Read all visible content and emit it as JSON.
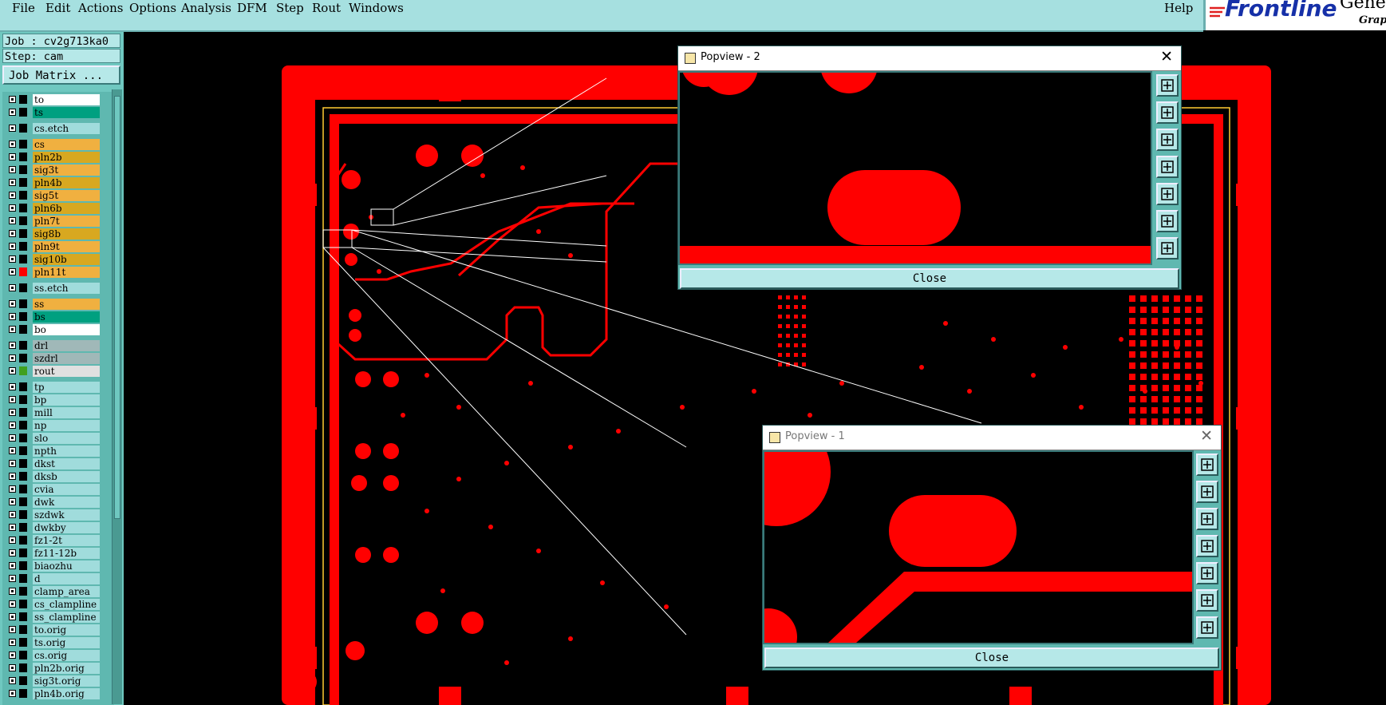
{
  "menubar": {
    "items": [
      "File",
      "Edit",
      "Actions",
      "Options",
      "Analysis",
      "DFM",
      "Step",
      "Rout",
      "Windows"
    ],
    "help": "Help"
  },
  "brand": {
    "name": "Frontline",
    "name2": "Gene",
    "sub": "Graph"
  },
  "job": {
    "job_label": "Job : cv2g713ka0",
    "step_label": "Step: cam",
    "matrix_button": "Job Matrix ..."
  },
  "layers": [
    {
      "name": "to",
      "color": "#ffffff",
      "tick": "#000000"
    },
    {
      "name": "ts",
      "color": "#00a080",
      "tick": "#000000"
    },
    {
      "name": "cs.etch",
      "color": "#a0dcdc",
      "tick": "#000000"
    },
    {
      "name": "cs",
      "color": "#f0b040",
      "tick": "#000000"
    },
    {
      "name": "pln2b",
      "color": "#d8a820",
      "tick": "#000000"
    },
    {
      "name": "sig3t",
      "color": "#f0b040",
      "tick": "#000000"
    },
    {
      "name": "pln4b",
      "color": "#d8a820",
      "tick": "#000000"
    },
    {
      "name": "sig5t",
      "color": "#f0b040",
      "tick": "#000000"
    },
    {
      "name": "pln6b",
      "color": "#d8a820",
      "tick": "#000000"
    },
    {
      "name": "pln7t",
      "color": "#f0b040",
      "tick": "#000000"
    },
    {
      "name": "sig8b",
      "color": "#d8a820",
      "tick": "#000000"
    },
    {
      "name": "pln9t",
      "color": "#f0b040",
      "tick": "#000000"
    },
    {
      "name": "sig10b",
      "color": "#d8a820",
      "tick": "#000000"
    },
    {
      "name": "pln11t",
      "color": "#f0b040",
      "tick": "#ff0000"
    },
    {
      "name": "ss.etch",
      "color": "#a0dcdc",
      "tick": "#000000"
    },
    {
      "name": "ss",
      "color": "#f0b040",
      "tick": "#000000"
    },
    {
      "name": "bs",
      "color": "#00a080",
      "tick": "#000000"
    },
    {
      "name": "bo",
      "color": "#ffffff",
      "tick": "#000000"
    },
    {
      "name": "drl",
      "color": "#a0b8b8",
      "tick": "#000000"
    },
    {
      "name": "szdrl",
      "color": "#a0b8b8",
      "tick": "#000000"
    },
    {
      "name": "rout",
      "color": "#e0e0e0",
      "tick": "#40a020"
    },
    {
      "name": "tp",
      "color": "#a0dcdc",
      "tick": "#000000"
    },
    {
      "name": "bp",
      "color": "#a0dcdc",
      "tick": "#000000"
    },
    {
      "name": "mill",
      "color": "#a0dcdc",
      "tick": "#000000"
    },
    {
      "name": "np",
      "color": "#a0dcdc",
      "tick": "#000000"
    },
    {
      "name": "slo",
      "color": "#a0dcdc",
      "tick": "#000000"
    },
    {
      "name": "npth",
      "color": "#a0dcdc",
      "tick": "#000000"
    },
    {
      "name": "dkst",
      "color": "#a0dcdc",
      "tick": "#000000"
    },
    {
      "name": "dksb",
      "color": "#a0dcdc",
      "tick": "#000000"
    },
    {
      "name": "cvia",
      "color": "#a0dcdc",
      "tick": "#000000"
    },
    {
      "name": "dwk",
      "color": "#a0dcdc",
      "tick": "#000000"
    },
    {
      "name": "szdwk",
      "color": "#a0dcdc",
      "tick": "#000000"
    },
    {
      "name": "dwkby",
      "color": "#a0dcdc",
      "tick": "#000000"
    },
    {
      "name": "fz1-2t",
      "color": "#a0dcdc",
      "tick": "#000000"
    },
    {
      "name": "fz11-12b",
      "color": "#a0dcdc",
      "tick": "#000000"
    },
    {
      "name": "biaozhu",
      "color": "#a0dcdc",
      "tick": "#000000"
    },
    {
      "name": "d",
      "color": "#a0dcdc",
      "tick": "#000000"
    },
    {
      "name": "clamp_area",
      "color": "#a0dcdc",
      "tick": "#000000"
    },
    {
      "name": "cs_clampline",
      "color": "#a0dcdc",
      "tick": "#000000"
    },
    {
      "name": "ss_clampline",
      "color": "#a0dcdc",
      "tick": "#000000"
    },
    {
      "name": "to.orig",
      "color": "#a0dcdc",
      "tick": "#000000"
    },
    {
      "name": "ts.orig",
      "color": "#a0dcdc",
      "tick": "#000000"
    },
    {
      "name": "cs.orig",
      "color": "#a0dcdc",
      "tick": "#000000"
    },
    {
      "name": "pln2b.orig",
      "color": "#a0dcdc",
      "tick": "#000000"
    },
    {
      "name": "sig3t.orig",
      "color": "#a0dcdc",
      "tick": "#000000"
    },
    {
      "name": "pln4b.orig",
      "color": "#a0dcdc",
      "tick": "#000000"
    }
  ],
  "popview2": {
    "title": "Popview - 2",
    "close_label": "Close"
  },
  "popview1": {
    "title": "Popview - 1",
    "close_label": "Close"
  },
  "tool_icons": [
    "zoom-home-icon",
    "pan-up-icon",
    "pan-down-icon",
    "pan-left-icon",
    "pan-right-icon",
    "zoom-out-icon",
    "zoom-fit-icon"
  ]
}
